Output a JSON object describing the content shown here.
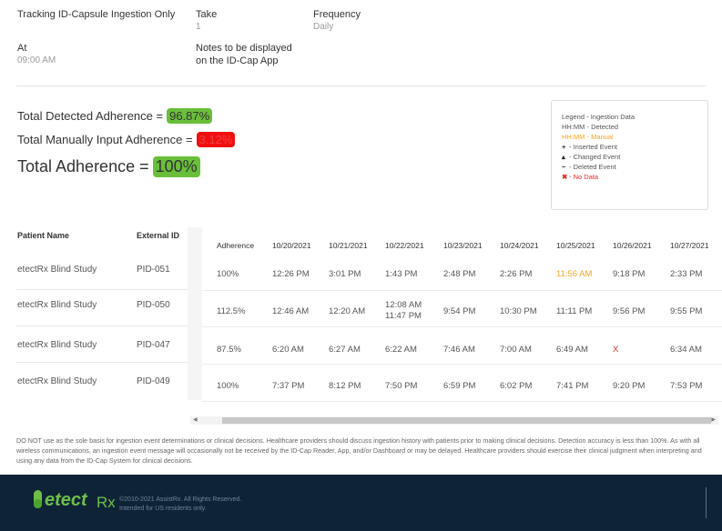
{
  "info": {
    "tracking_label": "Tracking ID-Capsule Ingestion Only",
    "take_label": "Take",
    "take_value": "1",
    "frequency_label": "Frequency",
    "frequency_value": "Daily",
    "at_label": "At",
    "at_value": "09:00 AM",
    "notes_line1": "Notes to be displayed",
    "notes_line2": "on the ID-Cap App"
  },
  "adherence": {
    "detected_label": "Total Detected Adherence =",
    "detected_value": "96.87%",
    "manual_label": "Total Manually Input Adherence =",
    "manual_value": "3.12%",
    "total_label": "Total Adherence =",
    "total_value": "100%"
  },
  "legend": {
    "title": "Legend - Ingestion Data",
    "detected": "HH:MM - Detected",
    "manual": "HH:MM - Manual",
    "inserted": "- Inserted Event",
    "changed": "- Changed Event",
    "deleted": "- Deleted Event",
    "nodata": "- No Data",
    "inserted_sym": "+",
    "changed_sym": "▴",
    "deleted_sym": "−",
    "nodata_sym": "✖",
    "colors": {
      "manual": "#f5a623",
      "nodata": "#e52b2b"
    }
  },
  "table": {
    "patient_header": "Patient Name",
    "external_header": "External ID",
    "adherence_header": "Adherence",
    "dates": [
      "10/20/2021",
      "10/21/2021",
      "10/22/2021",
      "10/23/2021",
      "10/24/2021",
      "10/25/2021",
      "10/26/2021",
      "10/27/2021"
    ],
    "rows": [
      {
        "patient": "etectRx Blind Study",
        "external_id": "PID-051",
        "adherence": "100%",
        "times": [
          "12:26 PM",
          "3:01 PM",
          "1:43 PM",
          "2:48 PM",
          "2:26 PM",
          "11:56 AM",
          "9:18 PM",
          "2:33 PM"
        ]
      },
      {
        "patient": "etectRx Blind Study",
        "external_id": "PID-050",
        "adherence": "112.5%",
        "times": [
          "12:46 AM",
          "12:20 AM",
          "12:08 AM",
          "9:54 PM",
          "10:30 PM",
          "11:11 PM",
          "9:56 PM",
          "9:55 PM"
        ],
        "extra_day3": "11:47 PM"
      },
      {
        "patient": "etectRx Blind Study",
        "external_id": "PID-047",
        "adherence": "87.5%",
        "times": [
          "6:20 AM",
          "6:27 AM",
          "6:22 AM",
          "7:46 AM",
          "7:00 AM",
          "6:49 AM",
          "X",
          "6:34 AM"
        ]
      },
      {
        "patient": "etectRx Blind Study",
        "external_id": "PID-049",
        "adherence": "100%",
        "times": [
          "7:37 PM",
          "8:12 PM",
          "7:50 PM",
          "6:59 PM",
          "6:02 PM",
          "7:41 PM",
          "9:20 PM",
          "7:53 PM"
        ]
      }
    ]
  },
  "scroll": {
    "left_arrow": "◀",
    "right_arrow": "▶"
  },
  "disclaimer": "DO NOT use as the sole basis for ingestion event determinations or clinical decisions. Healthcare providers should discuss ingestion history with patients prior to making clinical decisions. Detection accuracy is less than 100%. As with all wireless communications, an ingestion event message will occasionally not be received by the ID-Cap Reader, App, and/or Dashboard or may be delayed. Healthcare providers should exercise their clinical judgment when interpreting and using any data from the ID-Cap System for clinical decisions.",
  "footer": {
    "logo_text": "etect",
    "logo_rx": "Rx",
    "copyright": "©2010-2021 AssistRx. All Rights Reserved.",
    "note": "Intended for US residents only.",
    "colors": {
      "bg": "#0f2337",
      "logo": "#6cc04a"
    }
  }
}
